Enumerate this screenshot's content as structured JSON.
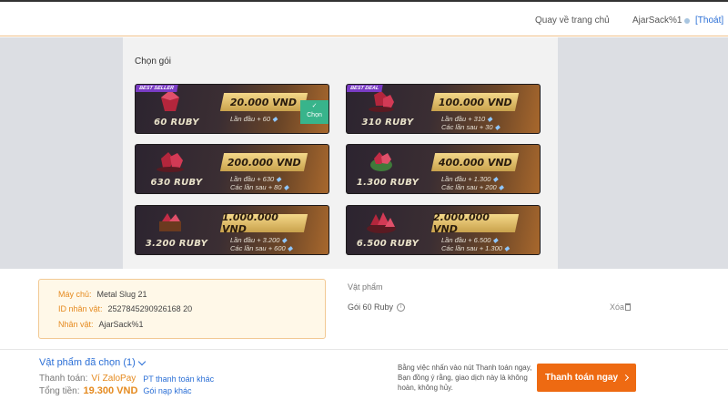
{
  "header": {
    "back_link": "Quay về trang chủ",
    "username": "AjarSack%1",
    "logout": "[Thoát]"
  },
  "packages_title": "Chọn gói",
  "packages": [
    {
      "badge": "BEST SELLER",
      "ruby": "60 RUBY",
      "price": "20.000 VND",
      "bonus_first": "Lần đầu + 60",
      "bonus_next": "",
      "selected": true,
      "selected_label": "Chọn"
    },
    {
      "badge": "BEST DEAL",
      "ruby": "310 RUBY",
      "price": "100.000 VND",
      "bonus_first": "Lần đầu + 310",
      "bonus_next": "Các lần sau + 30",
      "selected": false,
      "selected_label": ""
    },
    {
      "badge": "",
      "ruby": "630 RUBY",
      "price": "200.000 VND",
      "bonus_first": "Lần đầu + 630",
      "bonus_next": "Các lần sau + 80",
      "selected": false,
      "selected_label": ""
    },
    {
      "badge": "",
      "ruby": "1.300 RUBY",
      "price": "400.000 VND",
      "bonus_first": "Lần đầu + 1.300",
      "bonus_next": "Các lần sau + 200",
      "selected": false,
      "selected_label": ""
    },
    {
      "badge": "",
      "ruby": "3.200 RUBY",
      "price": "1.000.000 VND",
      "bonus_first": "Lần đầu + 3.200",
      "bonus_next": "Các lần sau + 600",
      "selected": false,
      "selected_label": ""
    },
    {
      "badge": "",
      "ruby": "6.500 RUBY",
      "price": "2.000.000 VND",
      "bonus_first": "Lần đầu + 6.500",
      "bonus_next": "Các lần sau + 1.300",
      "selected": false,
      "selected_label": ""
    }
  ],
  "account": {
    "server_label": "Máy chủ:",
    "server_value": "Metal Slug 21",
    "id_label": "ID nhân vật:",
    "id_value": "2527845290926168 20",
    "char_label": "Nhân vật:",
    "char_value": "AjarSack%1"
  },
  "item": {
    "title": "Vật phẩm",
    "name": "Gói 60 Ruby",
    "delete": "Xóa"
  },
  "footer": {
    "selected_items": "Vật phẩm đã chọn (1)",
    "payment_label": "Thanh toán:",
    "payment_method": "Ví ZaloPay",
    "other_payment": "PT thanh toán khác",
    "total_label": "Tổng tiền:",
    "total_amount": "19.300 VND",
    "gift_code": "Gói nạp khác",
    "terms": "Bằng việc nhấn vào nút Thanh toán ngay, Bạn đồng ý rằng, giao dịch này là không hoàn, không hủy.",
    "pay_button": "Thanh toán ngay"
  },
  "colors": {
    "accent": "#ee6a12",
    "link": "#2b6fd6",
    "label_orange": "#e58a1f",
    "selected_green": "#38b48b"
  }
}
